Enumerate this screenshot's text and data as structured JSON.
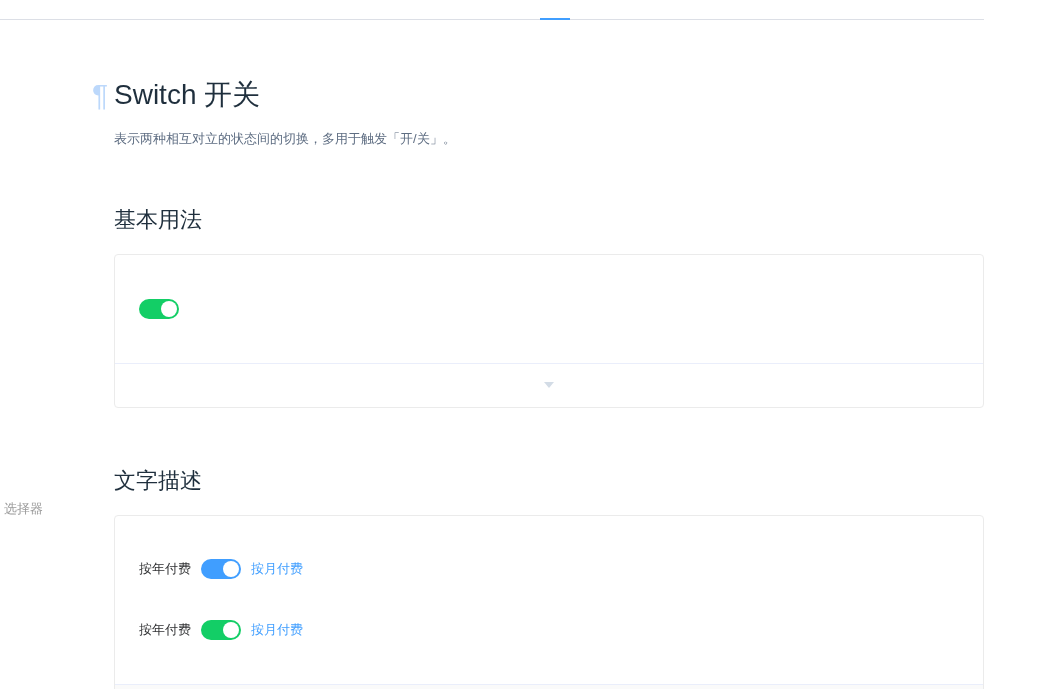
{
  "sidebar": {
    "items": [
      {
        "label": "选择器"
      }
    ]
  },
  "header": {
    "title": "Switch 开关",
    "anchor": "¶",
    "description": "表示两种相互对立的状态间的切换，多用于触发「开/关」。"
  },
  "sections": [
    {
      "title": "基本用法",
      "switches": [
        {
          "kind": "plain",
          "checked": true,
          "color": "#13ce66"
        }
      ]
    },
    {
      "title": "文字描述",
      "switches": [
        {
          "kind": "labeled",
          "checked": true,
          "color": "#409eff",
          "inactive_text": "按年付费",
          "active_text": "按月付费"
        },
        {
          "kind": "labeled",
          "checked": true,
          "color": "#13ce66",
          "inactive_text": "按年付费",
          "active_text": "按月付费"
        }
      ]
    }
  ]
}
